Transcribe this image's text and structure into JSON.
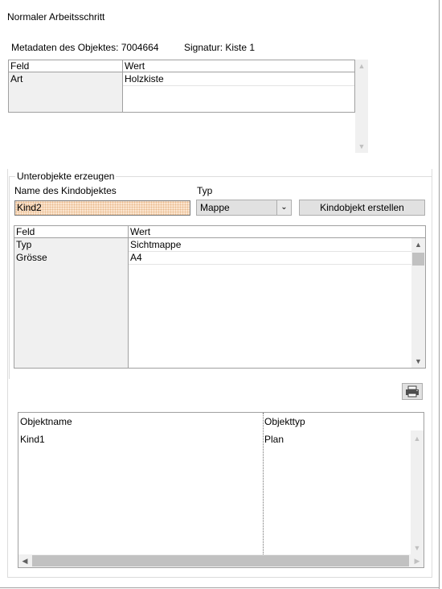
{
  "window": {
    "title": "Normaler Arbeitsschritt"
  },
  "metadata": {
    "label": "Metadaten des Objektes: 7004664",
    "signature": "Signatur: Kiste 1",
    "grid": {
      "headers": {
        "feld": "Feld",
        "wert": "Wert"
      },
      "rows": [
        {
          "feld": "Art",
          "wert": "Holzkiste"
        }
      ]
    }
  },
  "subobjects": {
    "group_title": "Unterobjekte erzeugen",
    "name_label": "Name des Kindobjektes",
    "name_value": "Kind2",
    "type_label": "Typ",
    "type_value": "Mappe",
    "create_button": "Kindobjekt erstellen",
    "grid": {
      "headers": {
        "feld": "Feld",
        "wert": "Wert"
      },
      "rows": [
        {
          "feld": "Typ",
          "wert": "Sichtmappe"
        },
        {
          "feld": "Grösse",
          "wert": "A4"
        }
      ]
    }
  },
  "objects_list": {
    "headers": {
      "name": "Objektname",
      "type": "Objekttyp"
    },
    "rows": [
      {
        "name": "Kind1",
        "type": "Plan"
      }
    ]
  },
  "icons": {
    "print": "printer-icon",
    "scroll_up": "chevron-up-icon",
    "scroll_down": "chevron-down-icon",
    "scroll_left": "chevron-left-icon",
    "dropdown": "chevron-down-icon"
  }
}
